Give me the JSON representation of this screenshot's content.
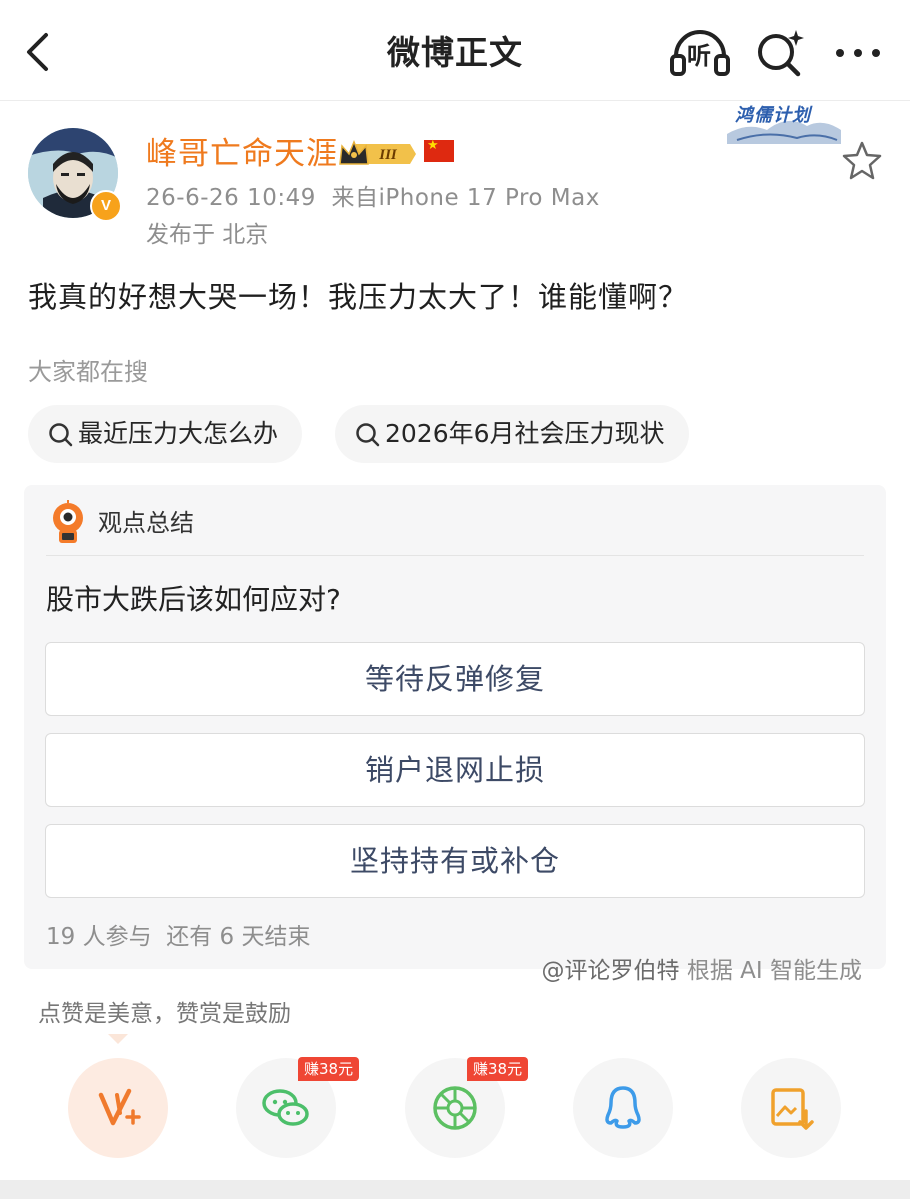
{
  "header": {
    "title": "微博正文",
    "listen_label": "听"
  },
  "author": {
    "name": "峰哥亡命天涯",
    "vip_level": "III",
    "verified_mark": "V",
    "timestamp": "26-6-26 10:49",
    "source": "来自iPhone 17 Pro Max",
    "location": "发布于 北京",
    "campaign_badge": "鸿儒计划"
  },
  "post": {
    "text": "我真的好想大哭一场！我压力太大了！谁能懂啊？"
  },
  "search": {
    "heading": "大家都在搜",
    "chips": [
      "最近压力大怎么办",
      "2026年6月社会压力现状"
    ]
  },
  "summary_card": {
    "title": "观点总结",
    "question": "股市大跌后该如何应对?",
    "options": [
      "等待反弹修复",
      "销户退网止损",
      "坚持持有或补仓"
    ],
    "participants": "19 人参与  还有 6 天结束",
    "ai_link": "@评论罗伯特",
    "ai_suffix": " 根据 AI 智能生成"
  },
  "share": {
    "prompt": "点赞是美意，赞赏是鼓励",
    "reward_tag": "赚38元",
    "items": [
      "reward-icon",
      "wechat-icon",
      "moments-icon",
      "qq-icon",
      "save-image-icon"
    ]
  },
  "colors": {
    "accent_orange": "#ef7a1e",
    "option_text": "#3d4a66",
    "reward_red": "#ef4634"
  }
}
